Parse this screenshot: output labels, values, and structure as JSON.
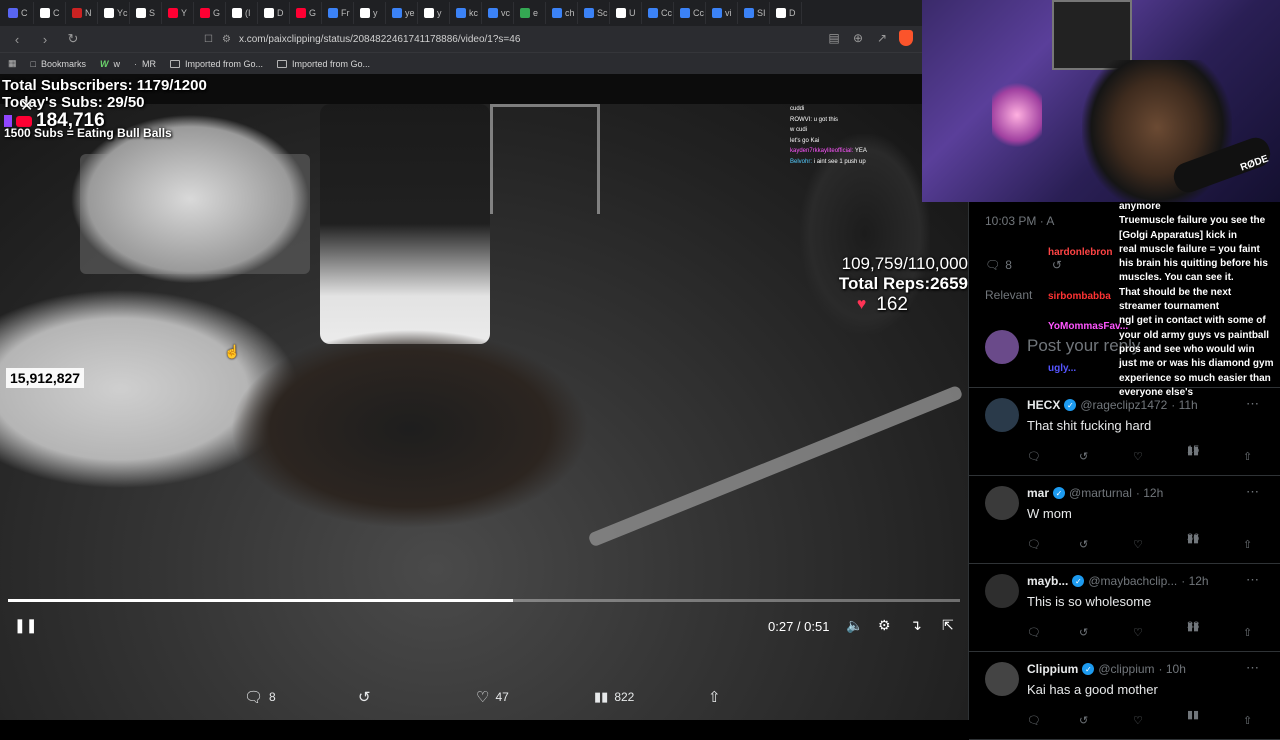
{
  "browser": {
    "tabs": [
      {
        "icon": "twitch-tab-icon",
        "label": "C",
        "color": "#5865f2"
      },
      {
        "icon": "x-tab-icon",
        "label": "C",
        "color": "#ffffff"
      },
      {
        "icon": "x-tab-icon",
        "label": "N",
        "color": "#cc2222"
      },
      {
        "icon": "x-tab-icon",
        "label": "Yc",
        "color": "#ffffff"
      },
      {
        "icon": "x-tab-icon",
        "label": "S",
        "color": "#ffffff"
      },
      {
        "icon": "youtube-tab-icon",
        "label": "Y",
        "color": "#ff0033"
      },
      {
        "icon": "youtube-tab-icon",
        "label": "G",
        "color": "#ff0033"
      },
      {
        "icon": "tiktok-tab-icon",
        "label": "(I",
        "color": "#ffffff"
      },
      {
        "icon": "x-tab-icon",
        "label": "D",
        "color": "#ffffff"
      },
      {
        "icon": "youtube-tab-icon",
        "label": "G",
        "color": "#ff0033"
      },
      {
        "icon": "doc-tab-icon",
        "label": "Fr",
        "color": "#3b82f6"
      },
      {
        "icon": "x-tab-icon",
        "label": "y",
        "color": "#ffffff"
      },
      {
        "icon": "doc-tab-icon",
        "label": "ye",
        "color": "#3b82f6"
      },
      {
        "icon": "x-tab-icon",
        "label": "y",
        "color": "#ffffff"
      },
      {
        "icon": "doc-tab-icon",
        "label": "kc",
        "color": "#3b82f6"
      },
      {
        "icon": "doc-tab-icon",
        "label": "vc",
        "color": "#3b82f6"
      },
      {
        "icon": "google-tab-icon",
        "label": "e",
        "color": "#34a853"
      },
      {
        "icon": "doc-tab-icon",
        "label": "ch",
        "color": "#3b82f6"
      },
      {
        "icon": "doc-tab-icon",
        "label": "Sc",
        "color": "#3b82f6"
      },
      {
        "icon": "x-tab-icon",
        "label": "U",
        "color": "#ffffff"
      },
      {
        "icon": "doc-tab-icon",
        "label": "Cc",
        "color": "#3b82f6"
      },
      {
        "icon": "doc-tab-icon",
        "label": "Cc",
        "color": "#3b82f6"
      },
      {
        "icon": "doc-tab-icon",
        "label": "vi",
        "color": "#3b82f6"
      },
      {
        "icon": "doc-tab-icon",
        "label": "SI",
        "color": "#3b82f6"
      },
      {
        "icon": "x-tab-icon",
        "label": "D",
        "color": "#ffffff"
      }
    ],
    "url": "x.com/paixclipping/status/2084822461741178886/video/1?s=46",
    "bookmarks": [
      {
        "label": "Bookmarks",
        "icon": "bookmarks-icon"
      },
      {
        "label": "w",
        "icon": "w-icon"
      },
      {
        "label": "MR",
        "icon": "mr-icon"
      },
      {
        "label": "Imported from Go...",
        "icon": "folder-icon"
      },
      {
        "label": "Imported from Go...",
        "icon": "folder-icon"
      }
    ]
  },
  "stream": {
    "total_subscribers": "Total Subscribers: 1179/1200",
    "todays_subs": "Today's Subs: 29/50",
    "youtube_count": "184,716",
    "goal_text": "1500 Subs = Eating Bull Balls",
    "view_count": "15,912,827",
    "rep_progress": "109,759/110,000",
    "total_reps": "Total Reps:2659",
    "heart_rate": "162",
    "chat_lines": [
      {
        "user": "",
        "text": "cuddi",
        "color": "#ffffff"
      },
      {
        "user": "ROWVI:",
        "text": "u got this",
        "color": "#ffffff"
      },
      {
        "user": "",
        "text": "w cudi",
        "color": "#ff5555"
      },
      {
        "user": "",
        "text": "let's go Kai",
        "color": "#ff5555"
      },
      {
        "user": "kayden7rkkayliteofficial:",
        "text": "YEA",
        "color": "#ff55ff"
      },
      {
        "user": "Belvohr:",
        "text": "i aint see 1 push up",
        "color": "#55ccff"
      }
    ]
  },
  "video": {
    "current_time": "0:27",
    "duration": "0:51",
    "progress": 0.53
  },
  "tweet": {
    "timestamp": "10:03 PM · A",
    "reply_count": "8",
    "relevant_label": "Relevant",
    "compose_placeholder": "Post your reply",
    "actions": {
      "replies": "8",
      "reposts": "",
      "likes": "47",
      "views": "822"
    }
  },
  "replies": [
    {
      "name": "HECX",
      "handle": "@rageclipz1472",
      "time": "· 11h",
      "text": "That shit fucking hard",
      "views": "15",
      "avatar_color": "#2a3a4a"
    },
    {
      "name": "mar",
      "handle": "@marturnal",
      "time": "· 12h",
      "text": "W mom",
      "views": "36",
      "avatar_color": "#3a3a3a"
    },
    {
      "name": "mayb...",
      "handle": "@maybachclip...",
      "time": "· 12h",
      "text": "This is so wholesome",
      "views": "38",
      "avatar_color": "#2e2e2e"
    },
    {
      "name": "Clippium",
      "handle": "@clippium",
      "time": "· 10h",
      "text": "Kai has a good mother",
      "views": "",
      "avatar_color": "#444444"
    }
  ],
  "chat_overlay": {
    "lines": [
      "anymore",
      "Truemuscle failure you see the",
      "[Golgi Apparatus] kick in",
      "real muscle failure = you faint",
      "his brain his quitting before his",
      "muscles. You can see it.",
      "That should be the next",
      "streamer tournament",
      "ngl get in contact with some of",
      "your old army guys vs paintball",
      "pros and see who would win",
      "just me or was his diamond gym",
      "experience so much easier than",
      "everyone else's"
    ],
    "users": [
      {
        "name": "hardonlebron",
        "color": "#ff4444"
      },
      {
        "name": "sirbombabba",
        "color": "#ff3333"
      },
      {
        "name": "YoMommasFav...",
        "color": "#ff55ff"
      },
      {
        "name": "ugly...",
        "color": "#5555ff"
      }
    ]
  },
  "cam": {
    "brand_text": "RØDE"
  }
}
